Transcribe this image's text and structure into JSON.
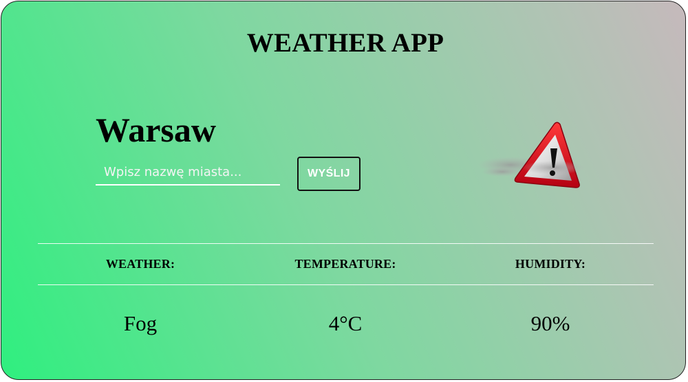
{
  "app": {
    "title": "WEATHER APP"
  },
  "location": {
    "city": "Warsaw"
  },
  "search": {
    "value": "",
    "placeholder": "Wpisz nazwę miasta...",
    "button_label": "WYŚLIJ"
  },
  "current_icon": {
    "icon": "warning-fog-icon"
  },
  "details": {
    "headers": [
      "WEATHER:",
      "TEMPERATURE:",
      "HUMIDITY:"
    ],
    "values": [
      "Fog",
      "4°C",
      "90%"
    ]
  },
  "colors": {
    "gradient_start": "#2fef7f",
    "gradient_end": "#c6b9bc",
    "warning_red": "#e0001a",
    "input_line": "#ffffff"
  }
}
